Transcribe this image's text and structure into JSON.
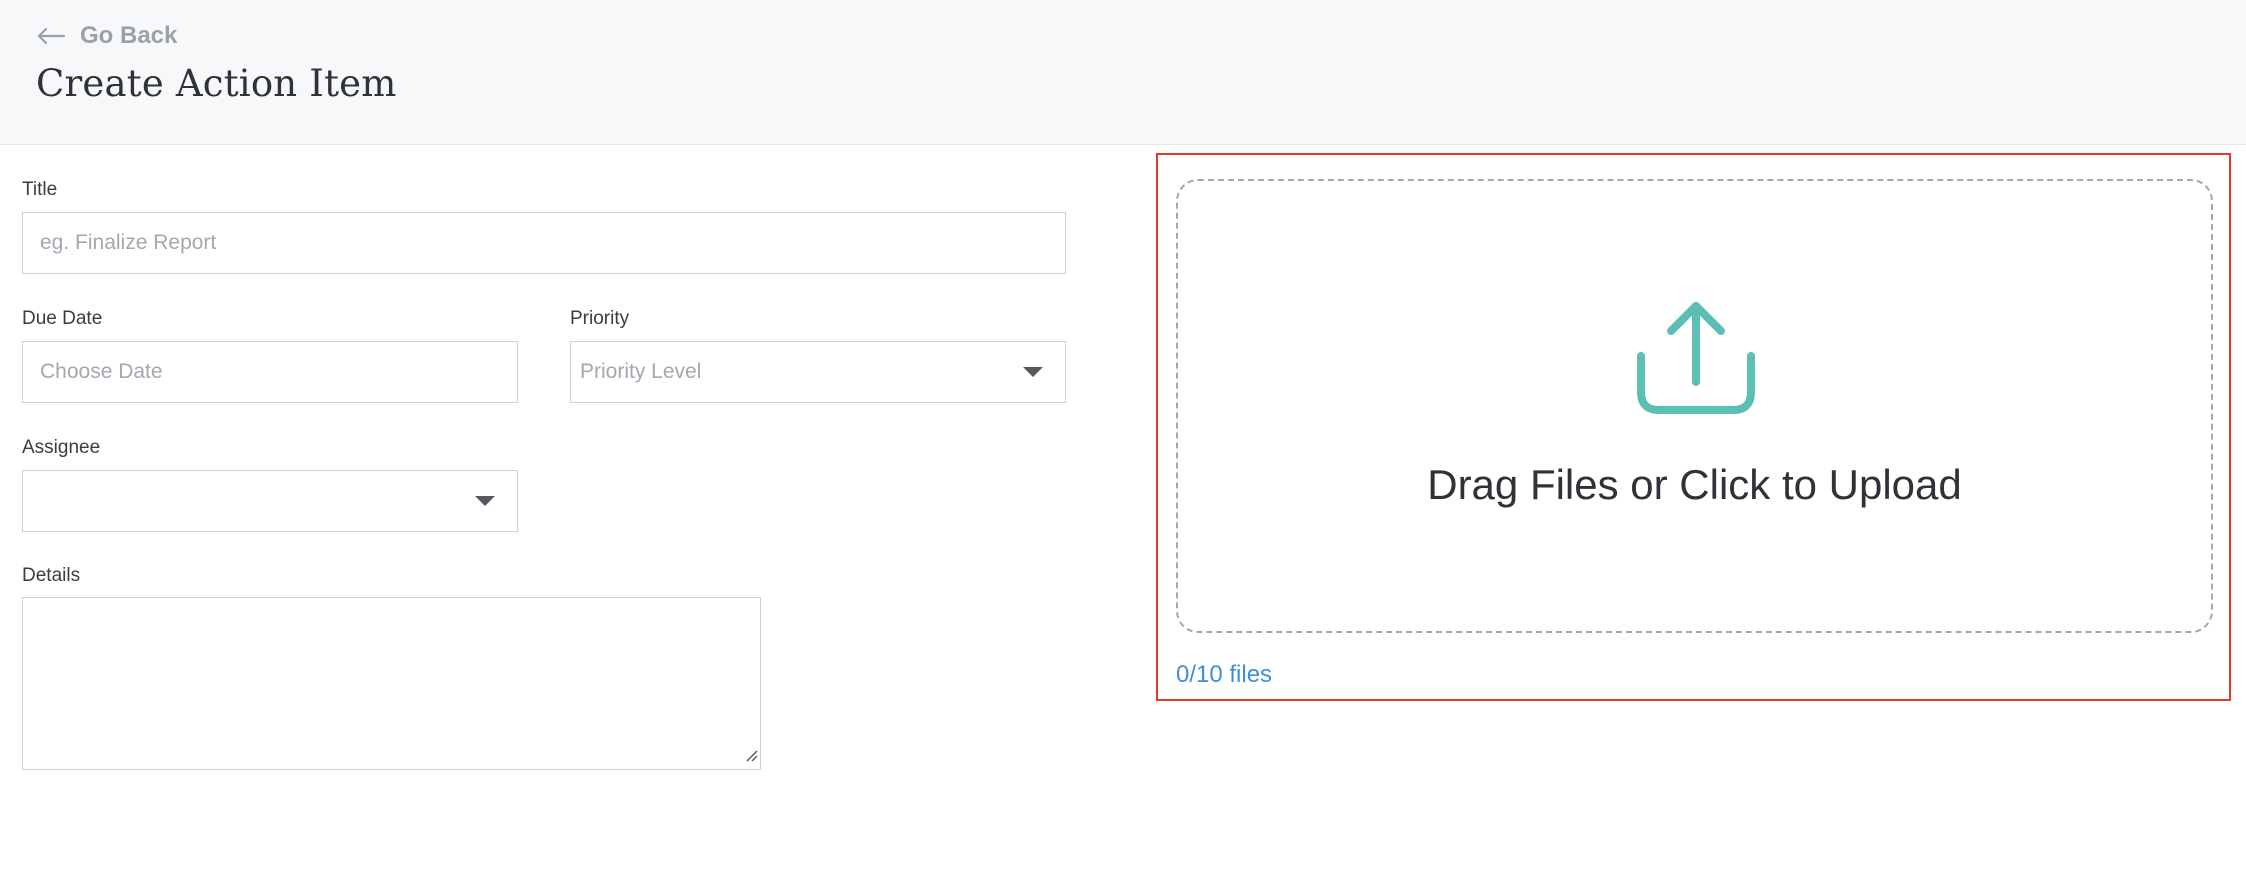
{
  "header": {
    "back_label": "Go Back",
    "page_title": "Create Action Item"
  },
  "form": {
    "title": {
      "label": "Title",
      "placeholder": "eg. Finalize Report",
      "value": ""
    },
    "due_date": {
      "label": "Due Date",
      "placeholder": "Choose Date",
      "value": ""
    },
    "priority": {
      "label": "Priority",
      "placeholder": "Priority Level"
    },
    "assignee": {
      "label": "Assignee",
      "value": ""
    },
    "details": {
      "label": "Details",
      "value": ""
    }
  },
  "upload": {
    "prompt": "Drag Files or Click to Upload",
    "file_count": "0/10 files",
    "icon": "upload-icon",
    "accent_color": "#5bbfb5",
    "highlight_color": "#e23b2e"
  },
  "colors": {
    "link": "#3d8fd6",
    "header_bg": "#f7f8fa"
  }
}
